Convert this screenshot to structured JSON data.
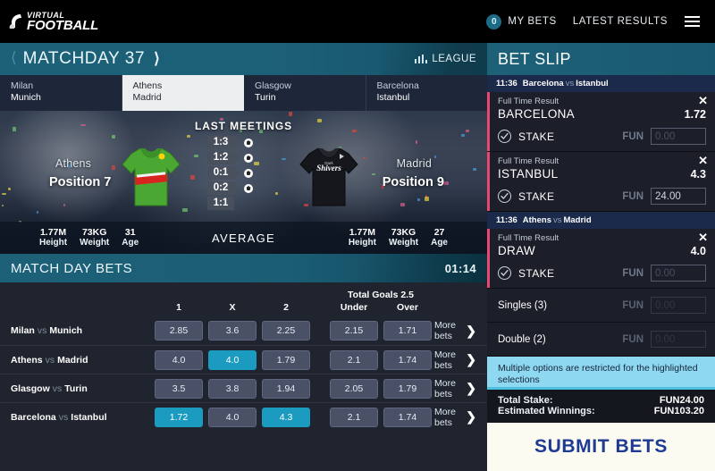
{
  "header": {
    "logo_line1": "VIRTUAL",
    "logo_line2": "FOOTBALL",
    "logo_icon": "football-boot-icon",
    "bets_count": "0",
    "my_bets_label": "MY BETS",
    "latest_results_label": "LATEST RESULTS",
    "menu_icon": "hamburger-menu-icon"
  },
  "matchday": {
    "title": "MATCHDAY 37",
    "prev_icon": "chevron-left-icon",
    "next_icon": "chevron-right-icon",
    "league_label": "LEAGUE",
    "league_icon": "bar-chart-icon"
  },
  "tabs": [
    {
      "home": "Milan",
      "away": "Munich",
      "active": false
    },
    {
      "home": "Athens",
      "away": "Madrid",
      "active": true
    },
    {
      "home": "Glasgow",
      "away": "Turin",
      "active": false
    },
    {
      "home": "Barcelona",
      "away": "Istanbul",
      "active": false
    }
  ],
  "preview": {
    "last_meetings_title": "LAST MEETINGS",
    "last_meetings": [
      "1:3",
      "1:2",
      "0:1",
      "0:2",
      "1:1"
    ],
    "average_label": "AVERAGE",
    "home": {
      "name": "Athens",
      "position": "Position 7",
      "shirt_color": "#4aa832",
      "shirt_text": "",
      "height": "1.77M",
      "height_label": "Height",
      "weight": "73KG",
      "weight_label": "Weight",
      "age": "31",
      "age_label": "Age"
    },
    "away": {
      "name": "Madrid",
      "position": "Position 9",
      "shirt_color": "#15171c",
      "shirt_text": "Shivers",
      "height": "1.77M",
      "height_label": "Height",
      "weight": "73KG",
      "weight_label": "Weight",
      "age": "27",
      "age_label": "Age"
    }
  },
  "match_day_bets": {
    "title": "MATCH DAY BETS",
    "timer": "01:14",
    "columns": [
      "1",
      "X",
      "2"
    ],
    "total_goals_title": "Total Goals 2.5",
    "total_goals_columns": [
      "Under",
      "Over"
    ],
    "more_bets_label": "More bets",
    "more_bets_icon": "chevron-right-icon",
    "rows": [
      {
        "home": "Milan",
        "vs": "vs",
        "away": "Munich",
        "odds": [
          {
            "value": "2.85",
            "selected": false
          },
          {
            "value": "3.6",
            "selected": false
          },
          {
            "value": "2.25",
            "selected": false
          }
        ],
        "goals": [
          {
            "value": "2.15",
            "selected": false
          },
          {
            "value": "1.71",
            "selected": false
          }
        ]
      },
      {
        "home": "Athens",
        "vs": "vs",
        "away": "Madrid",
        "odds": [
          {
            "value": "4.0",
            "selected": false
          },
          {
            "value": "4.0",
            "selected": true
          },
          {
            "value": "1.79",
            "selected": false
          }
        ],
        "goals": [
          {
            "value": "2.1",
            "selected": false
          },
          {
            "value": "1.74",
            "selected": false
          }
        ]
      },
      {
        "home": "Glasgow",
        "vs": "vs",
        "away": "Turin",
        "odds": [
          {
            "value": "3.5",
            "selected": false
          },
          {
            "value": "3.8",
            "selected": false
          },
          {
            "value": "1.94",
            "selected": false
          }
        ],
        "goals": [
          {
            "value": "2.05",
            "selected": false
          },
          {
            "value": "1.79",
            "selected": false
          }
        ]
      },
      {
        "home": "Barcelona",
        "vs": "vs",
        "away": "Istanbul",
        "odds": [
          {
            "value": "1.72",
            "selected": true
          },
          {
            "value": "4.0",
            "selected": false
          },
          {
            "value": "4.3",
            "selected": true
          }
        ],
        "goals": [
          {
            "value": "2.1",
            "selected": false
          },
          {
            "value": "1.74",
            "selected": false
          }
        ]
      }
    ]
  },
  "bet_slip": {
    "title": "BET SLIP",
    "currency": "FUN",
    "stake_label": "STAKE",
    "close_icon": "close-icon",
    "check_icon": "check-circle-icon",
    "groups": [
      {
        "time": "11:36",
        "home": "Barcelona",
        "vs": "vs",
        "away": "Istanbul",
        "items": [
          {
            "market": "Full Time Result",
            "pick": "BARCELONA",
            "odds": "1.72",
            "stake": "0.00",
            "stake_empty": true
          },
          {
            "market": "Full Time Result",
            "pick": "ISTANBUL",
            "odds": "4.3",
            "stake": "24.00",
            "stake_empty": false
          }
        ]
      },
      {
        "time": "11:36",
        "home": "Athens",
        "vs": "vs",
        "away": "Madrid",
        "items": [
          {
            "market": "Full Time Result",
            "pick": "DRAW",
            "odds": "4.0",
            "stake": "0.00",
            "stake_empty": true
          }
        ]
      }
    ],
    "combos": [
      {
        "label": "Singles (3)",
        "stake": "0.00"
      },
      {
        "label": "Double (2)",
        "stake": "0.00"
      }
    ],
    "notice": "Multiple options are restricted for the highlighted selections",
    "total_stake_label": "Total Stake:",
    "total_stake_value": "FUN24.00",
    "estimated_winnings_label": "Estimated Winnings:",
    "estimated_winnings_value": "FUN103.20",
    "submit_label": "SUBMIT BETS"
  },
  "colors": {
    "teal": "#1b9bc0",
    "header_teal": "#1d6179",
    "accent_red": "#e8476f",
    "notice_blue": "#8fd8f2",
    "submit_text": "#1f3a93"
  }
}
